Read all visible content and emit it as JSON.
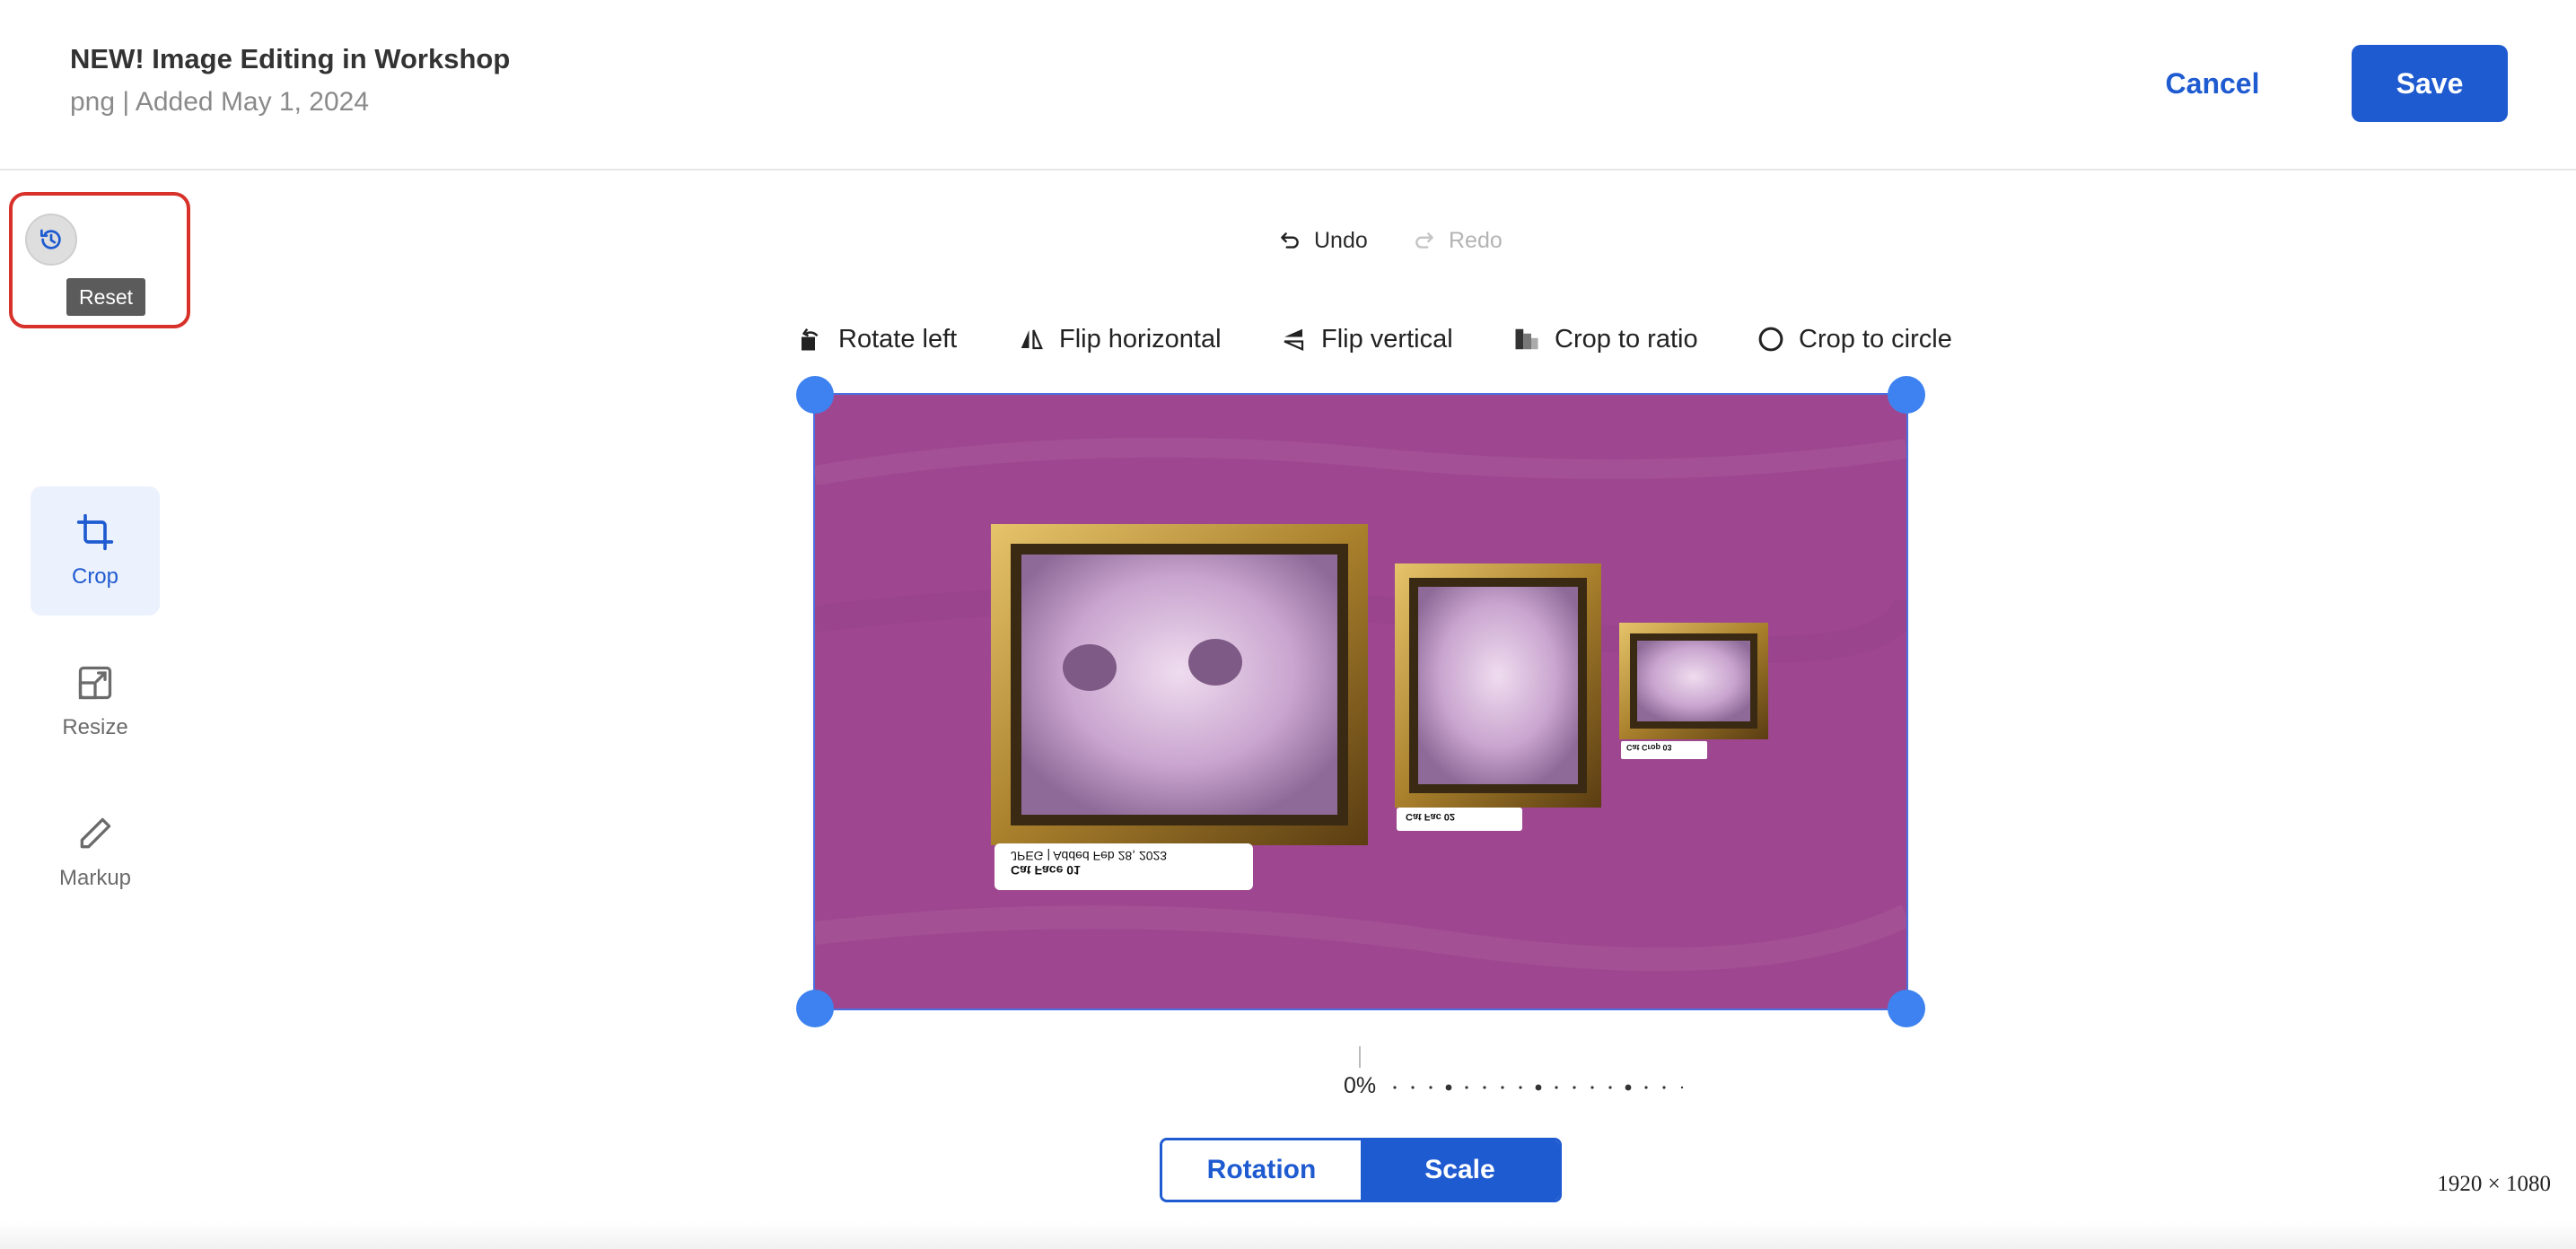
{
  "header": {
    "title": "NEW! Image Editing in Workshop",
    "subtitle": "png | Added May 1, 2024",
    "cancel_label": "Cancel",
    "save_label": "Save"
  },
  "reset": {
    "tooltip": "Reset",
    "icon": "history-reset-icon"
  },
  "sidebar": {
    "items": [
      {
        "label": "Crop",
        "icon": "crop-icon",
        "active": true
      },
      {
        "label": "Resize",
        "icon": "resize-icon",
        "active": false
      },
      {
        "label": "Markup",
        "icon": "pencil-icon",
        "active": false
      }
    ]
  },
  "history": {
    "undo_label": "Undo",
    "redo_label": "Redo"
  },
  "toolbar": {
    "rotate_left": "Rotate left",
    "flip_horizontal": "Flip horizontal",
    "flip_vertical": "Flip vertical",
    "crop_to_ratio": "Crop to ratio",
    "crop_to_circle": "Crop to circle"
  },
  "image": {
    "label_large": "Cat Face 01",
    "meta_large": "JPEG | Added Feb 28, 2023",
    "label_medium": "Cat Fac 02",
    "label_small": "Cat Crop 03"
  },
  "dial": {
    "value_label": "0%"
  },
  "mode_toggle": {
    "rotation_label": "Rotation",
    "scale_label": "Scale",
    "selected": "Scale"
  },
  "dimensions": "1920 × 1080",
  "colors": {
    "accent": "#1f5bd0",
    "canvas_bg": "#9e4790",
    "handle": "#3d82f0",
    "reset_highlight": "#d7312a"
  }
}
